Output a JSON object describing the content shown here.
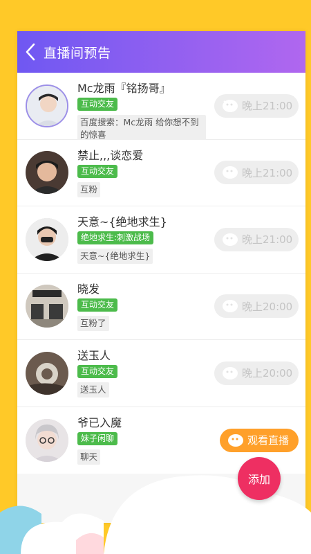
{
  "header": {
    "title": "直播间预告"
  },
  "rows": [
    {
      "name": "Mc龙雨『铭扬哥』",
      "tag": "互动交友",
      "desc": "百度搜索：Mc龙雨  给你想不到的惊喜",
      "time": "晚上21:00"
    },
    {
      "name": "禁止,,,谈恋爱",
      "tag": "互动交友",
      "desc": "互粉",
      "time": "晚上21:00"
    },
    {
      "name": "天意~{绝地求生}",
      "tag": "绝地求生:刺激战场",
      "desc": "天意~{绝地求生}",
      "time": "晚上21:00"
    },
    {
      "name": "晓发",
      "tag": "互动交友",
      "desc": "互粉了",
      "time": "晚上20:00"
    },
    {
      "name": "送玉人",
      "tag": "互动交友",
      "desc": "送玉人",
      "time": "晚上20:00"
    },
    {
      "name": "爷已入魔",
      "tag": "妹子闲聊",
      "desc": "聊天",
      "action": "观看直播"
    }
  ],
  "fab": {
    "label": "添加"
  },
  "colors": {
    "header_start": "#6F58F2",
    "header_end": "#B067EF",
    "tag_green": "#4CBB4B",
    "watch_orange": "#FFA02A",
    "fab_pink": "#EE2F62",
    "background": "#FFC928"
  }
}
